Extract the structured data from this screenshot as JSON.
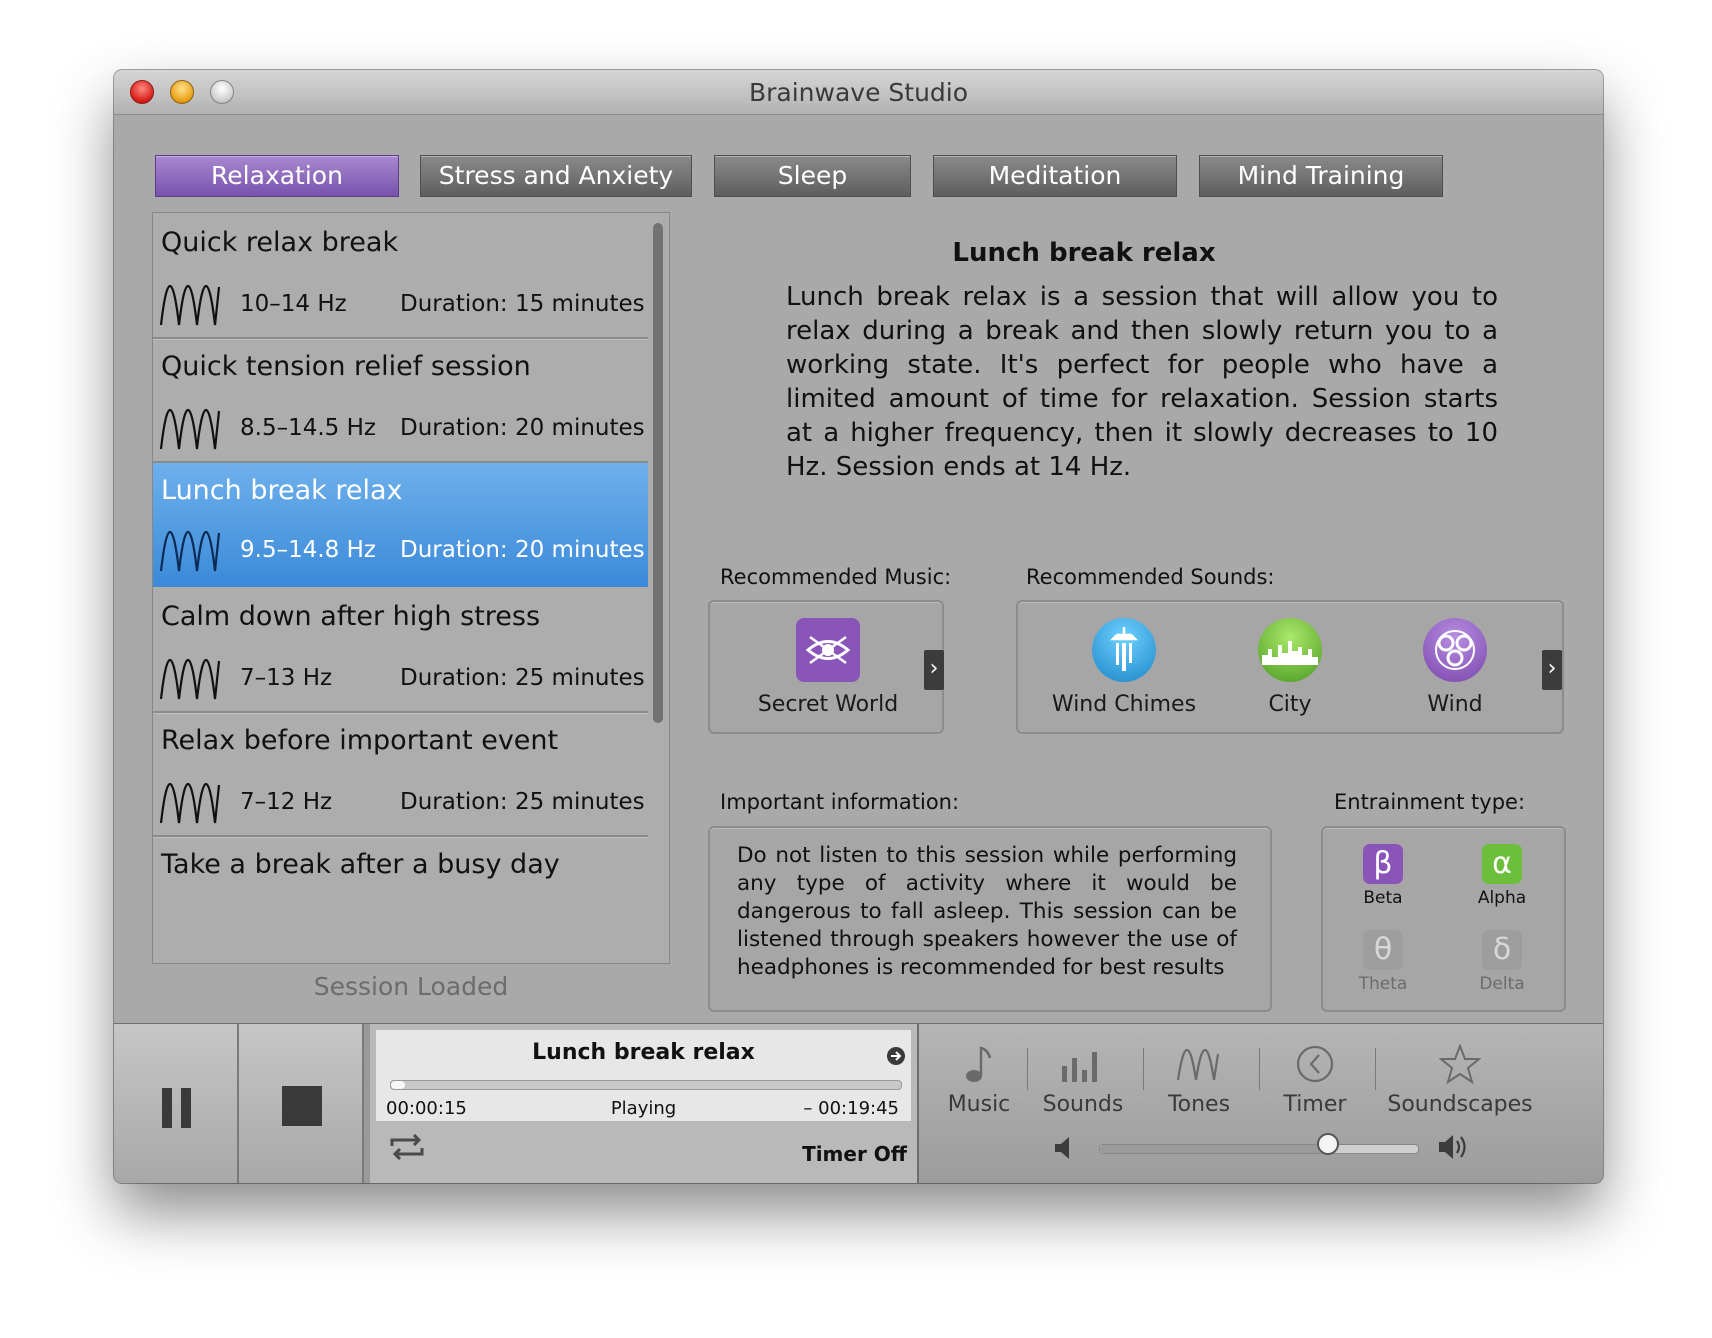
{
  "window": {
    "title": "Brainwave Studio"
  },
  "tabs": [
    {
      "label": "Relaxation",
      "active": true
    },
    {
      "label": "Stress and Anxiety",
      "active": false
    },
    {
      "label": "Sleep",
      "active": false
    },
    {
      "label": "Meditation",
      "active": false
    },
    {
      "label": "Mind Training",
      "active": false
    }
  ],
  "sessions": [
    {
      "title": "Quick relax break",
      "hz": "10–14 Hz",
      "duration": "Duration: 15 minutes",
      "selected": false
    },
    {
      "title": "Quick tension relief session",
      "hz": "8.5–14.5 Hz",
      "duration": "Duration: 20 minutes",
      "selected": false
    },
    {
      "title": "Lunch break relax",
      "hz": "9.5–14.8 Hz",
      "duration": "Duration: 20 minutes",
      "selected": true
    },
    {
      "title": "Calm down after high stress",
      "hz": "7–13 Hz",
      "duration": "Duration: 25 minutes",
      "selected": false
    },
    {
      "title": "Relax before important event",
      "hz": "7–12 Hz",
      "duration": "Duration: 25 minutes",
      "selected": false
    },
    {
      "title": "Take a break after a busy day",
      "hz": "",
      "duration": "",
      "selected": false
    }
  ],
  "session_status": "Session Loaded",
  "detail": {
    "title": "Lunch break relax",
    "description": "Lunch break relax is a session that will allow you to relax during a break and then slowly return you to a working state. It's perfect for people who have a limited amount of time for relaxation. Session starts at a higher frequency, then it slowly decreases to 10 Hz. Session ends at 14 Hz."
  },
  "recommended_music": {
    "label": "Recommended Music:",
    "items": [
      {
        "name": "Secret World",
        "icon": "secret-world-icon",
        "color": "#8a55b8"
      }
    ]
  },
  "recommended_sounds": {
    "label": "Recommended Sounds:",
    "items": [
      {
        "name": "Wind Chimes",
        "icon": "wind-chimes-icon",
        "color": "#2a9fd8"
      },
      {
        "name": "City",
        "icon": "city-icon",
        "color": "#6cbf3b"
      },
      {
        "name": "Wind",
        "icon": "wind-icon",
        "color": "#8a55b8"
      }
    ]
  },
  "important": {
    "label": "Important information:",
    "text": "Do not listen to this session while performing any type of activity where it would be dangerous to fall asleep. This session can be listened through speakers however the use of headphones is recommended for best results"
  },
  "entrainment": {
    "label": "Entrainment type:",
    "items": [
      {
        "name": "Beta",
        "symbol": "β",
        "color": "#8a55b8",
        "enabled": true
      },
      {
        "name": "Alpha",
        "symbol": "α",
        "color": "#6cbf3b",
        "enabled": true
      },
      {
        "name": "Theta",
        "symbol": "θ",
        "color": "#9d9d9d",
        "enabled": false
      },
      {
        "name": "Delta",
        "symbol": "δ",
        "color": "#9d9d9d",
        "enabled": false
      }
    ]
  },
  "player": {
    "title": "Lunch break relax",
    "elapsed": "00:00:15",
    "status": "Playing",
    "remaining": "– 00:19:45",
    "progress": 0.0125,
    "timer": "Timer Off"
  },
  "nav": [
    {
      "label": "Music",
      "icon": "music-note-icon"
    },
    {
      "label": "Sounds",
      "icon": "sound-bars-icon"
    },
    {
      "label": "Tones",
      "icon": "tone-wave-icon"
    },
    {
      "label": "Timer",
      "icon": "clock-icon"
    },
    {
      "label": "Soundscapes",
      "icon": "star-icon"
    }
  ],
  "volume": 0.72
}
